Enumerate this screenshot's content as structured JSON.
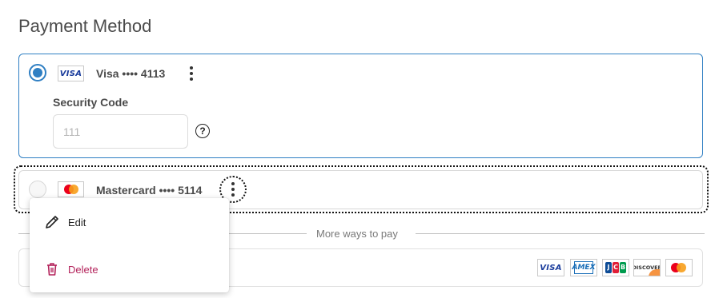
{
  "page": {
    "title": "Payment Method"
  },
  "cards": [
    {
      "brand": "VISA",
      "label": "Visa •••• 4113",
      "selected": true
    },
    {
      "brand": "mastercard",
      "label": "Mastercard •••• 5114",
      "selected": false
    }
  ],
  "security": {
    "label": "Security Code",
    "placeholder": "111",
    "help": "?"
  },
  "divider": {
    "text": "More ways to pay"
  },
  "menu": {
    "edit": "Edit",
    "delete": "Delete"
  },
  "accepted_brands": [
    "visa-logo",
    "amex-logo",
    "jcb-logo",
    "discover-logo",
    "mastercard-logo"
  ],
  "brand_texts": {
    "visa": "VISA",
    "amex": "AMEX",
    "jcb": [
      "J",
      "C",
      "B"
    ],
    "discover": "DISCOVER"
  },
  "colors": {
    "accent": "#2f7fc3",
    "delete": "#b3215a",
    "mc_red": "#eb001b",
    "mc_orange": "#f79e1b"
  }
}
